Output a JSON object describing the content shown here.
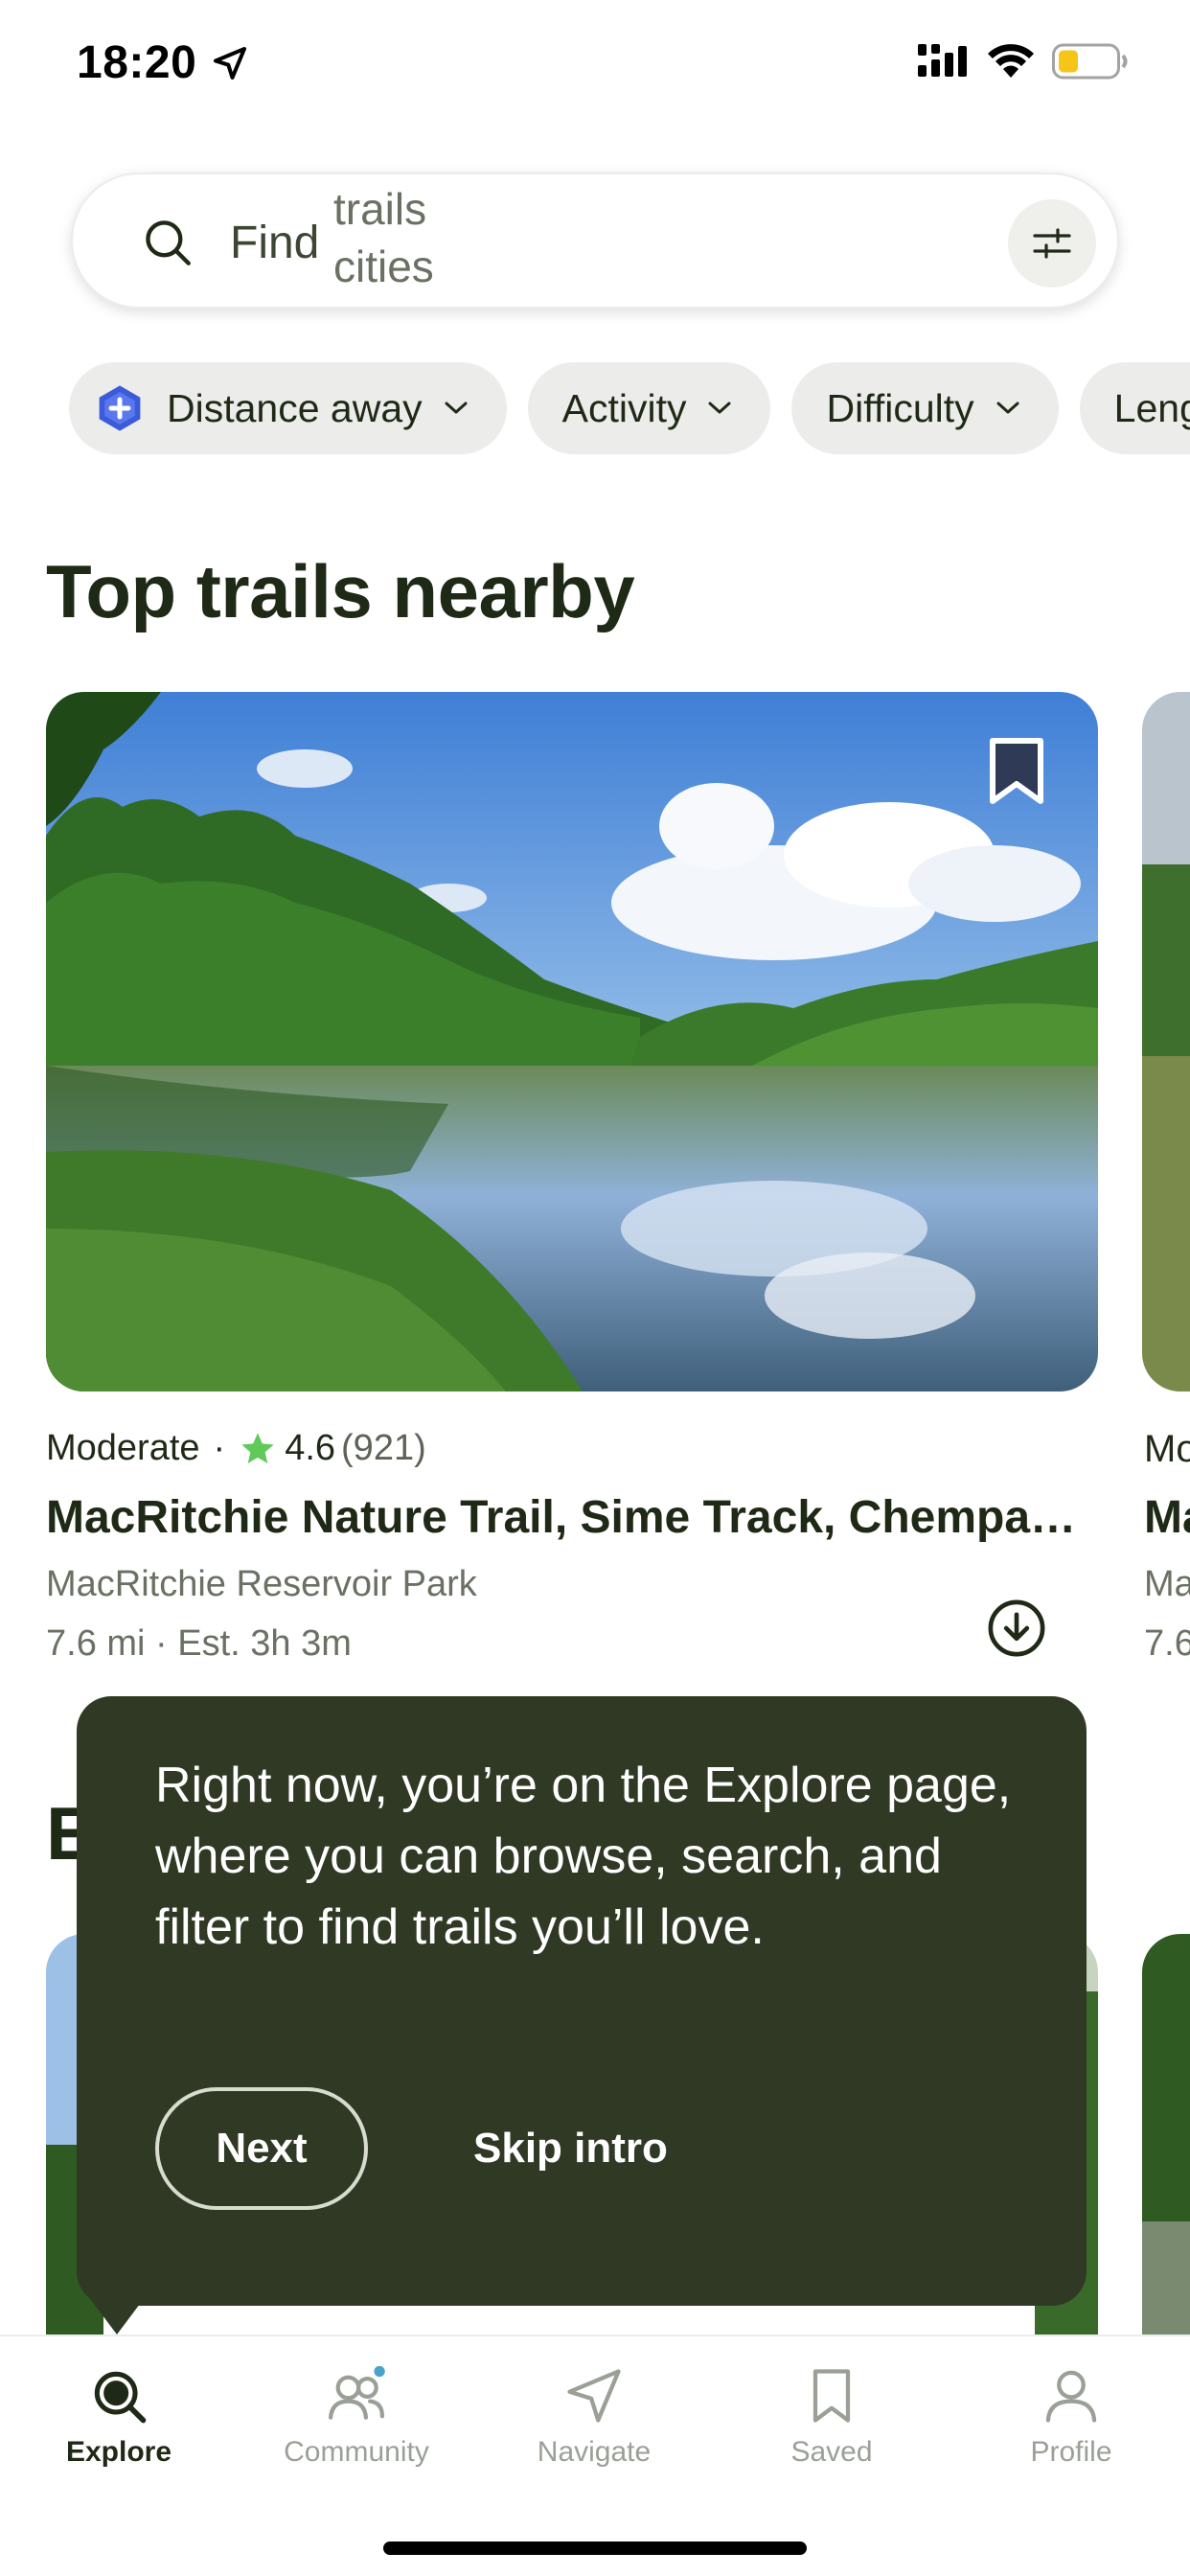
{
  "status": {
    "time": "18:20",
    "battery_color": "#f5c518"
  },
  "search": {
    "prefix": "Find",
    "rotating": [
      "trails",
      "cities"
    ]
  },
  "filters": {
    "chips": [
      "Distance away",
      "Activity",
      "Difficulty",
      "Leng"
    ]
  },
  "section": {
    "title": "Top trails nearby",
    "next_title_partial": "E"
  },
  "trail": {
    "difficulty": "Moderate",
    "rating": "4.6",
    "reviews": "(921)",
    "name": "MacRitchie Nature Trail, Sime Track, Chempa…",
    "park": "MacRitchie Reservoir Park",
    "distance": "7.6 mi",
    "duration": "Est. 3h 3m"
  },
  "peek": {
    "difficulty": "Mo",
    "name": "Ma",
    "park": "Ma",
    "distance": "7.6"
  },
  "tooltip": {
    "text": "Right now, you’re on the Explore page,\nwhere you can browse, search, and filter to find trails you’ll love.",
    "next_label": "Next",
    "skip_label": "Skip intro"
  },
  "nav": {
    "items": [
      {
        "label": "Explore",
        "icon": "search-icon",
        "active": true
      },
      {
        "label": "Community",
        "icon": "community-icon"
      },
      {
        "label": "Navigate",
        "icon": "navigate-icon"
      },
      {
        "label": "Saved",
        "icon": "bookmark-icon"
      },
      {
        "label": "Profile",
        "icon": "profile-icon"
      }
    ]
  },
  "colors": {
    "brand_dark": "#2f3924",
    "text_dark": "#1f2a16",
    "star": "#5fc95a",
    "notification_dot": "#4aa3c8"
  }
}
